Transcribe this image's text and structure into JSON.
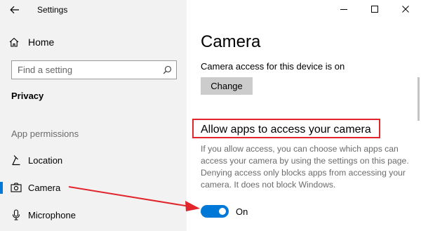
{
  "window": {
    "title": "Settings",
    "controls": [
      "minimize",
      "maximize",
      "close"
    ]
  },
  "sidebar": {
    "home_label": "Home",
    "search_placeholder": "Find a setting",
    "section_title": "Privacy",
    "group_header": "App permissions",
    "items": [
      {
        "label": "Location",
        "icon": "location-icon",
        "selected": false
      },
      {
        "label": "Camera",
        "icon": "camera-icon",
        "selected": true
      },
      {
        "label": "Microphone",
        "icon": "microphone-icon",
        "selected": false
      }
    ]
  },
  "main": {
    "page_title": "Camera",
    "device_status": "Camera access for this device is on",
    "change_label": "Change",
    "allow_heading": "Allow apps to access your camera",
    "description": "If you allow access, you can choose which apps can access your camera by using the settings on this page. Denying access only blocks apps from accessing your camera. It does not block Windows.",
    "toggle_state": "On",
    "toggle_on": true
  },
  "colors": {
    "accent": "#0078d7",
    "annotation": "#e1252b",
    "sidebar_bg": "#f2f2f2"
  }
}
